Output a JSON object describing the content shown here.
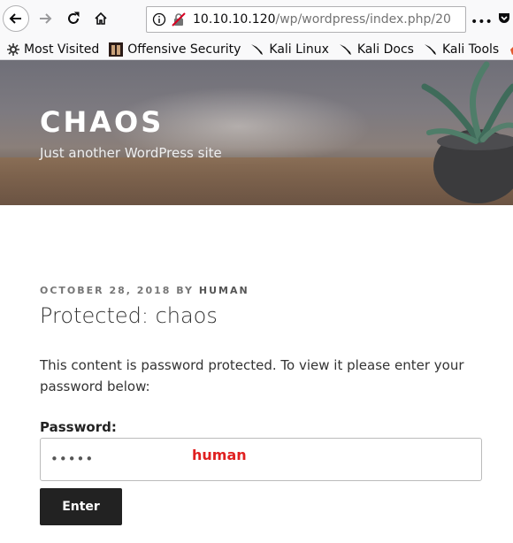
{
  "browser": {
    "url_prefix": "10.10.10.120",
    "url_rest": "/wp/wordpress/index.php/20",
    "page_actions_label": "•••"
  },
  "bookmarks": [
    {
      "label": "Most Visited",
      "icon": "gear-icon"
    },
    {
      "label": "Offensive Security",
      "icon": "offsec-icon"
    },
    {
      "label": "Kali Linux",
      "icon": "kali-dragon-icon"
    },
    {
      "label": "Kali Docs",
      "icon": "kali-dragon-icon"
    },
    {
      "label": "Kali Tools",
      "icon": "kali-dragon-icon"
    }
  ],
  "site": {
    "title": "CHAOS",
    "description": "Just another WordPress site"
  },
  "post": {
    "date": "OCTOBER 28, 2018",
    "by": "BY",
    "author": "HUMAN",
    "title": "Protected: chaos",
    "text": "This content is password protected. To view it please enter your password below:",
    "password_label": "Password:",
    "password_mask": "•••••",
    "annotation": "human",
    "enter_label": "Enter"
  },
  "colors": {
    "annotation": "#e02020",
    "button_bg": "#222222"
  }
}
